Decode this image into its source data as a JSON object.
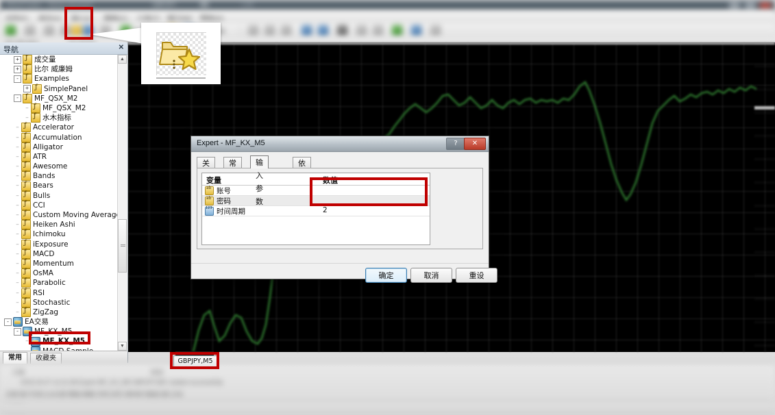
{
  "window": {
    "app_title": "MetaTrader - Demo Account",
    "title_segment_2": "GBPJPY",
    "title_segment_3": "M5",
    "title_segment_4": "1.00"
  },
  "menubar": {
    "items": [
      "文件(F)",
      "显示(V)",
      "插入(I)",
      "图表(C)",
      "工具(T)",
      "窗口(W)",
      "帮助(H)"
    ]
  },
  "toolbar": {
    "label_insert": "插入(I)",
    "navigator_icon_name": "navigator-folder-star-icon",
    "tooltip_icons": [
      "new-order-icon",
      "chart-icon",
      "navigator-icon",
      "terminal-icon"
    ]
  },
  "callout": {
    "icon_name": "folder-with-star-icon",
    "caption": ""
  },
  "navigator": {
    "title": "导航",
    "close_label": "✕",
    "tabs": [
      {
        "label": "常用",
        "active": true
      },
      {
        "label": "收藏夹",
        "active": false
      }
    ],
    "tree": [
      {
        "label": "成交量",
        "indent": 1,
        "expander": "+",
        "icon": "indicator-icon"
      },
      {
        "label": "比尔 威廉姆",
        "indent": 1,
        "expander": "+",
        "icon": "indicator-icon"
      },
      {
        "label": "Examples",
        "indent": 1,
        "expander": "-",
        "icon": "indicator-icon"
      },
      {
        "label": "SimplePanel",
        "indent": 2,
        "expander": "+",
        "icon": "indicator-icon"
      },
      {
        "label": "MF_QSX_M2",
        "indent": 1,
        "expander": "-",
        "icon": "indicator-icon"
      },
      {
        "label": "MF_QSX_M2",
        "indent": 2,
        "expander": "",
        "icon": "indicator-icon"
      },
      {
        "label": "水木指标",
        "indent": 2,
        "expander": "",
        "icon": "indicator-icon"
      },
      {
        "label": "Accelerator",
        "indent": 1,
        "expander": "",
        "icon": "indicator-icon"
      },
      {
        "label": "Accumulation",
        "indent": 1,
        "expander": "",
        "icon": "indicator-icon"
      },
      {
        "label": "Alligator",
        "indent": 1,
        "expander": "",
        "icon": "indicator-icon"
      },
      {
        "label": "ATR",
        "indent": 1,
        "expander": "",
        "icon": "indicator-icon"
      },
      {
        "label": "Awesome",
        "indent": 1,
        "expander": "",
        "icon": "indicator-icon"
      },
      {
        "label": "Bands",
        "indent": 1,
        "expander": "",
        "icon": "indicator-icon"
      },
      {
        "label": "Bears",
        "indent": 1,
        "expander": "",
        "icon": "indicator-icon"
      },
      {
        "label": "Bulls",
        "indent": 1,
        "expander": "",
        "icon": "indicator-icon"
      },
      {
        "label": "CCI",
        "indent": 1,
        "expander": "",
        "icon": "indicator-icon"
      },
      {
        "label": "Custom Moving Averages",
        "indent": 1,
        "expander": "",
        "icon": "indicator-icon"
      },
      {
        "label": "Heiken Ashi",
        "indent": 1,
        "expander": "",
        "icon": "indicator-icon"
      },
      {
        "label": "Ichimoku",
        "indent": 1,
        "expander": "",
        "icon": "indicator-icon"
      },
      {
        "label": "iExposure",
        "indent": 1,
        "expander": "",
        "icon": "indicator-icon"
      },
      {
        "label": "MACD",
        "indent": 1,
        "expander": "",
        "icon": "indicator-icon"
      },
      {
        "label": "Momentum",
        "indent": 1,
        "expander": "",
        "icon": "indicator-icon"
      },
      {
        "label": "OsMA",
        "indent": 1,
        "expander": "",
        "icon": "indicator-icon"
      },
      {
        "label": "Parabolic",
        "indent": 1,
        "expander": "",
        "icon": "indicator-icon"
      },
      {
        "label": "RSI",
        "indent": 1,
        "expander": "",
        "icon": "indicator-icon"
      },
      {
        "label": "Stochastic",
        "indent": 1,
        "expander": "",
        "icon": "indicator-icon"
      },
      {
        "label": "ZigZag",
        "indent": 1,
        "expander": "",
        "icon": "indicator-icon"
      },
      {
        "label": "EA交易",
        "indent": 0,
        "expander": "-",
        "icon": "expert-icon"
      },
      {
        "label": "MF_KX_M5",
        "indent": 1,
        "expander": "-",
        "icon": "expert-icon"
      },
      {
        "label": "MF_KX_M5",
        "indent": 2,
        "expander": "",
        "icon": "expert-icon",
        "highlighted": true
      },
      {
        "label": "MACD Sample",
        "indent": 2,
        "expander": "",
        "icon": "expert-icon"
      }
    ]
  },
  "chart": {
    "symbol_tab": "GBPJPY,M5"
  },
  "dialog": {
    "title": "Expert - MF_KX_M5",
    "help_label": "?",
    "close_label": "✕",
    "tabs": [
      {
        "label": "关于",
        "active": false
      },
      {
        "label": "常用",
        "active": false
      },
      {
        "label": "输入参数",
        "active": true
      },
      {
        "label": "依存关系",
        "active": false
      }
    ],
    "table": {
      "headers": [
        "变量",
        "数值"
      ],
      "rows": [
        {
          "name": "账号",
          "value": "",
          "icon": "string-param-icon"
        },
        {
          "name": "密码",
          "value": "",
          "icon": "string-param-icon"
        },
        {
          "name": "时间周期",
          "value": "2",
          "icon": "number-param-icon"
        }
      ]
    },
    "buttons": [
      {
        "label": "确定",
        "primary": true
      },
      {
        "label": "取消",
        "primary": false
      },
      {
        "label": "重设",
        "primary": false
      }
    ]
  },
  "highlights": {
    "accent_color": "#c00000",
    "boxes": [
      "toolbar-navigator-button",
      "tree-item-mf-kx-m5",
      "chart-symbol-tab",
      "input-value-cells"
    ]
  }
}
